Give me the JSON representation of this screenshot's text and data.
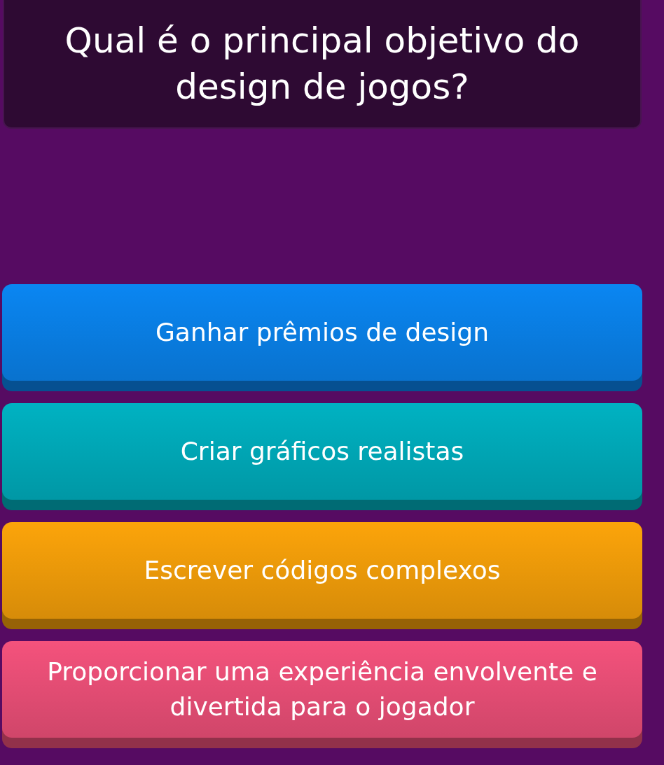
{
  "question": "Qual é o principal objetivo do design de jogos?",
  "options": [
    {
      "label": "Ganhar prêmios de design",
      "color": "#0a86f2"
    },
    {
      "label": "Criar gráficos realistas",
      "color": "#00b2c2"
    },
    {
      "label": "Escrever códigos complexos",
      "color": "#fca40a"
    },
    {
      "label": "Proporcionar uma experiência envolvente e divertida para o jogador",
      "color": "#f4527c"
    }
  ]
}
